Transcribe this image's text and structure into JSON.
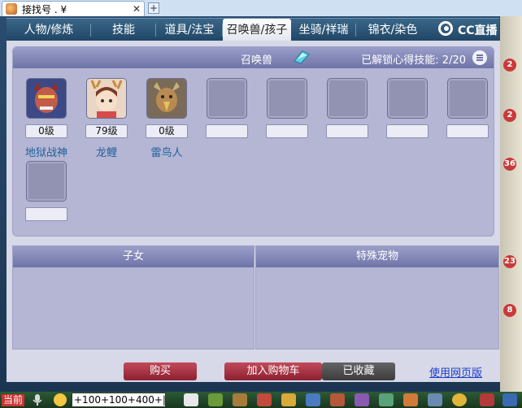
{
  "browser": {
    "tab_title": "接找号 . ¥",
    "close_glyph": "✕",
    "new_tab_glyph": "+"
  },
  "categories": [
    {
      "label": "人物/修炼"
    },
    {
      "label": "技能"
    },
    {
      "label": "道具/法宝"
    },
    {
      "label": "召唤兽/孩子"
    },
    {
      "label": "坐骑/祥瑞"
    },
    {
      "label": "锦衣/染色"
    }
  ],
  "watermark": "CC直播",
  "side_badges": [
    "2",
    "2",
    "36",
    "23",
    "8"
  ],
  "panel": {
    "title": "召唤兽",
    "unlock_label": "已解锁心得技能:",
    "unlock_count": "2/20"
  },
  "pets": [
    {
      "level": "0级",
      "name": "地狱战神",
      "icon": "demon-avatar-icon"
    },
    {
      "level": "79级",
      "name": "龙鲤",
      "icon": "girl-avatar-icon"
    },
    {
      "level": "0级",
      "name": "雷鸟人",
      "icon": "thunderbird-avatar-icon"
    },
    {
      "level": "",
      "name": ""
    },
    {
      "level": "",
      "name": ""
    },
    {
      "level": "",
      "name": ""
    },
    {
      "level": "",
      "name": ""
    },
    {
      "level": "",
      "name": ""
    },
    {
      "level": "",
      "name": ""
    }
  ],
  "sections": {
    "children": "子女",
    "special_pets": "特殊宠物"
  },
  "buttons": {
    "buy": "购买",
    "add_cart": "加入购物车",
    "favorited": "已收藏",
    "web": "使用网页版"
  },
  "taskbar": {
    "current": "当前",
    "input_value": "+100+100+400+|"
  },
  "colors": {
    "accent_red": "#c24a5a",
    "name_blue": "#1f5f9a",
    "header_purple": "#8a8ec0"
  }
}
